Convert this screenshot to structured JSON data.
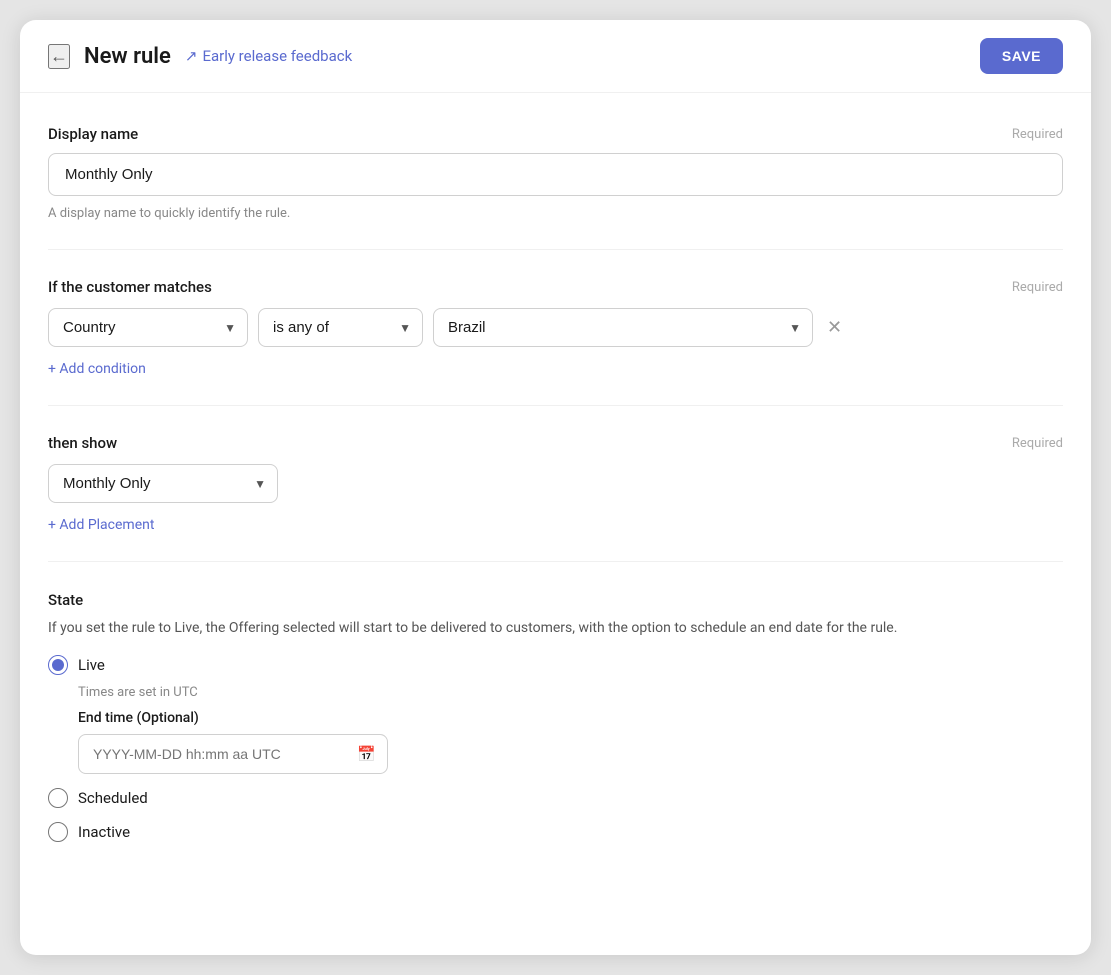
{
  "header": {
    "back_label": "←",
    "title": "New rule",
    "feedback_label": "Early release feedback",
    "save_label": "SAVE"
  },
  "display_name_section": {
    "label": "Display name",
    "required": "Required",
    "value": "Monthly Only",
    "hint": "A display name to quickly identify the rule."
  },
  "condition_section": {
    "label": "If the customer matches",
    "required": "Required",
    "country_value": "Country",
    "operator_value": "is any of",
    "match_value": "Brazil",
    "add_condition_label": "+ Add condition"
  },
  "then_show_section": {
    "label": "then show",
    "required": "Required",
    "placement_value": "Monthly Only",
    "add_placement_label": "+ Add Placement"
  },
  "state_section": {
    "label": "State",
    "description": "If you set the rule to Live, the Offering selected will start to be delivered to customers, with the option to schedule an end date for the rule.",
    "options": [
      {
        "id": "live",
        "label": "Live",
        "checked": true
      },
      {
        "id": "scheduled",
        "label": "Scheduled",
        "checked": false
      },
      {
        "id": "inactive",
        "label": "Inactive",
        "checked": false
      }
    ],
    "timezone_note": "Times are set in UTC",
    "end_time_label": "End time (Optional)",
    "end_time_placeholder": "YYYY-MM-DD hh:mm aa UTC"
  }
}
